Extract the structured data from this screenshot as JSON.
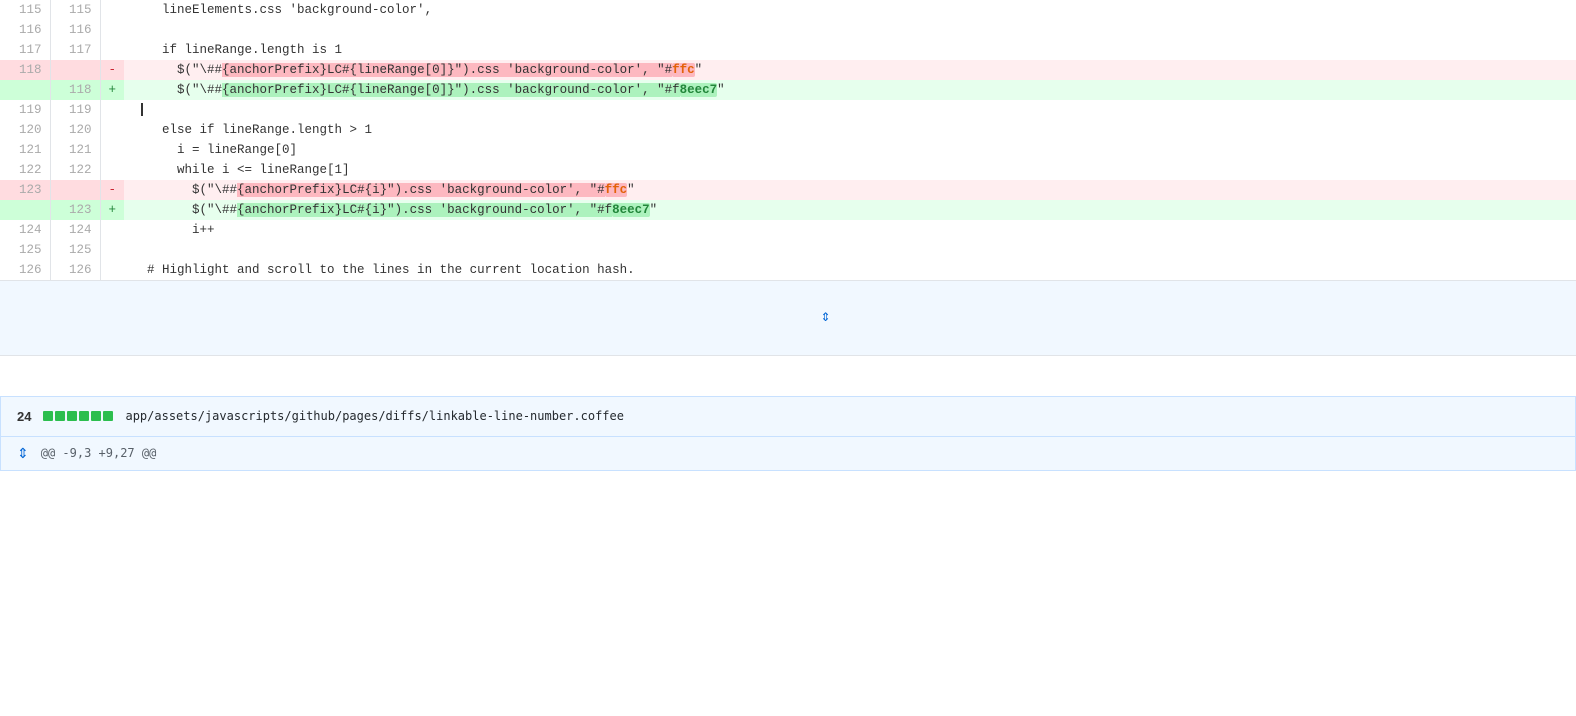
{
  "diff": {
    "lines": [
      {
        "id": "l115",
        "old_num": "115",
        "new_num": "115",
        "type": "context",
        "sign": "",
        "code": "    lineElements.css 'background-color',"
      },
      {
        "id": "l116",
        "old_num": "116",
        "new_num": "116",
        "type": "context",
        "sign": "",
        "code": ""
      },
      {
        "id": "l117",
        "old_num": "117",
        "new_num": "117",
        "type": "context",
        "sign": "",
        "code": "    if lineRange.length is 1"
      },
      {
        "id": "l118-del",
        "old_num": "118",
        "new_num": "",
        "type": "deleted",
        "sign": "-",
        "code_parts": [
          {
            "text": "      $(\"\\##",
            "hl": false
          },
          {
            "text": "{anchorPrefix}LC#",
            "hl": false
          },
          {
            "text": "{lineRange[0]}\").css 'background-color', \"#ffc\"",
            "hl": false
          }
        ]
      },
      {
        "id": "l118-add",
        "old_num": "",
        "new_num": "118",
        "type": "added",
        "sign": "+",
        "code_parts": [
          {
            "text": "      $(\"\\##",
            "hl": false
          },
          {
            "text": "{anchorPrefix}LC#",
            "hl": false
          },
          {
            "text": "{lineRange[0]}\").css 'background-color', \"#f8eec7\"",
            "hl": false
          }
        ]
      },
      {
        "id": "l119",
        "old_num": "119",
        "new_num": "119",
        "type": "context",
        "sign": "",
        "code": ""
      },
      {
        "id": "l120",
        "old_num": "120",
        "new_num": "120",
        "type": "context",
        "sign": "",
        "code": "    else if lineRange.length > 1"
      },
      {
        "id": "l121",
        "old_num": "121",
        "new_num": "121",
        "type": "context",
        "sign": "",
        "code": "      i = lineRange[0]"
      },
      {
        "id": "l122",
        "old_num": "122",
        "new_num": "122",
        "type": "context",
        "sign": "",
        "code": "      while i <= lineRange[1]"
      },
      {
        "id": "l123-del",
        "old_num": "123",
        "new_num": "",
        "type": "deleted",
        "sign": "-",
        "code_parts": [
          {
            "text": "        $(\"\\##",
            "hl": false
          },
          {
            "text": "{anchorPrefix}LC#",
            "hl": false
          },
          {
            "text": "{i}\").css 'background-color', \"#ffc\"",
            "hl": false
          }
        ]
      },
      {
        "id": "l123-add",
        "old_num": "",
        "new_num": "123",
        "type": "added",
        "sign": "+",
        "code_parts": [
          {
            "text": "        $(\"\\##",
            "hl": false
          },
          {
            "text": "{anchorPrefix}LC#",
            "hl": false
          },
          {
            "text": "{i}\").css 'background-color', \"#f8eec7\"",
            "hl": false
          }
        ]
      },
      {
        "id": "l124",
        "old_num": "124",
        "new_num": "124",
        "type": "context",
        "sign": "",
        "code": "        i++"
      },
      {
        "id": "l125",
        "old_num": "125",
        "new_num": "125",
        "type": "context",
        "sign": "",
        "code": ""
      },
      {
        "id": "l126",
        "old_num": "126",
        "new_num": "126",
        "type": "context",
        "sign": "",
        "code": "  # Highlight and scroll to the lines in the current location hash."
      }
    ],
    "expander": {
      "icon": "⇕"
    }
  },
  "file_section": {
    "number": "24",
    "stats": [
      "added",
      "added",
      "added",
      "added",
      "added",
      "added"
    ],
    "path": "app/assets/javascripts/github/pages/diffs/linkable-line-number.coffee",
    "hunk": {
      "icon": "⇕",
      "range": "@@ -9,3 +9,27 @@"
    }
  }
}
